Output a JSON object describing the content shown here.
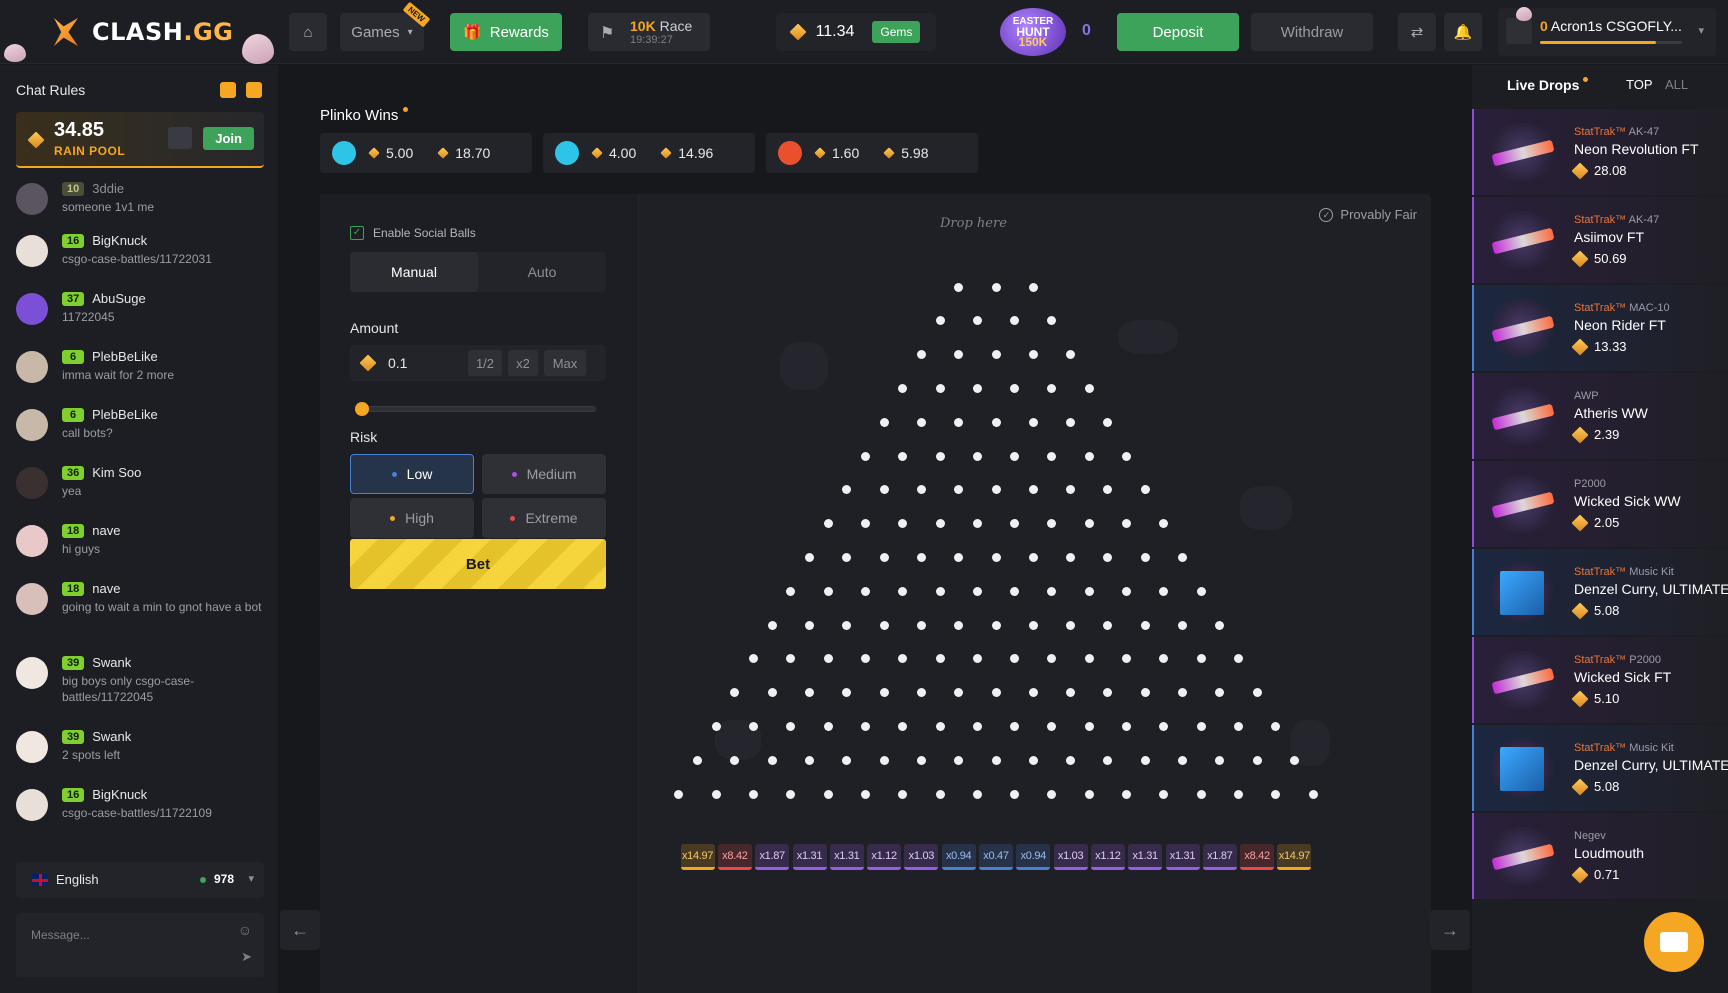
{
  "brand": {
    "name": "CLASH",
    "suffix": ".GG"
  },
  "topbar": {
    "games_label": "Games",
    "new_tag": "NEW",
    "rewards_label": "Rewards",
    "race_amount": "10K",
    "race_label": "Race",
    "race_timer": "19:39:27",
    "balance": "11.34",
    "gems_label": "Gems",
    "easter_line1": "EASTER",
    "easter_line2": "HUNT",
    "easter_line3": "150K",
    "easter_count": "0",
    "deposit_label": "Deposit",
    "withdraw_label": "Withdraw",
    "user_level": "0",
    "user_name": "Acron1s CSGOFLY..."
  },
  "chat": {
    "title": "Chat Rules",
    "rain_amount": "34.85",
    "rain_label": "RAIN POOL",
    "join_label": "Join",
    "messages": [
      {
        "level": "10",
        "user": "3ddie",
        "text": "someone 1v1 me",
        "dim": true
      },
      {
        "level": "16",
        "user": "BigKnuck",
        "text": "csgo-case-battles/11722031"
      },
      {
        "level": "37",
        "user": "AbuSuge",
        "text": "11722045"
      },
      {
        "level": "6",
        "user": "PlebBeLike",
        "text": "imma wait for 2 more"
      },
      {
        "level": "6",
        "user": "PlebBeLike",
        "text": "call bots?"
      },
      {
        "level": "36",
        "user": "Kim Soo",
        "text": "yea"
      },
      {
        "level": "18",
        "user": "nave",
        "text": "hi guys"
      },
      {
        "level": "18",
        "user": "nave",
        "text": "going to wait a min to gnot have a bot"
      },
      {
        "level": "39",
        "user": "Swank",
        "text": "big boys only csgo-case-battles/11722045"
      },
      {
        "level": "39",
        "user": "Swank",
        "text": "2 spots left"
      },
      {
        "level": "16",
        "user": "BigKnuck",
        "text": "csgo-case-battles/11722109"
      }
    ],
    "language": "English",
    "online_count": "978",
    "message_placeholder": "Message..."
  },
  "plinko_wins": {
    "title": "Plinko Wins",
    "cards": [
      {
        "bet": "5.00",
        "win": "18.70",
        "icon_color": "#2ec4e8"
      },
      {
        "bet": "4.00",
        "win": "14.96",
        "icon_color": "#2ec4e8"
      },
      {
        "bet": "1.60",
        "win": "5.98",
        "icon_color": "#e8502e"
      }
    ]
  },
  "controls": {
    "social_balls_label": "Enable Social Balls",
    "tab_manual": "Manual",
    "tab_auto": "Auto",
    "amount_label": "Amount",
    "amount_value": "0.1",
    "half_label": "1/2",
    "double_label": "x2",
    "max_label": "Max",
    "slider_value": 0,
    "risk_label": "Risk",
    "risk_low": "Low",
    "risk_medium": "Medium",
    "risk_high": "High",
    "risk_extreme": "Extreme",
    "bet_label": "Bet"
  },
  "board": {
    "provably_fair": "Provably Fair",
    "drop_here": "Drop here",
    "multipliers": [
      "x14.97",
      "x8.42",
      "x1.87",
      "x1.31",
      "x1.31",
      "x1.12",
      "x1.03",
      "x0.94",
      "x0.47",
      "x0.94",
      "x1.03",
      "x1.12",
      "x1.31",
      "x1.31",
      "x1.87",
      "x8.42",
      "x14.97"
    ],
    "multiplier_colors": [
      "#f5a623",
      "#e84a4a",
      "#9a5ae8",
      "#9a5ae8",
      "#9a5ae8",
      "#9a5ae8",
      "#9a5ae8",
      "#4a7fd6",
      "#4a7fd6",
      "#4a7fd6",
      "#9a5ae8",
      "#9a5ae8",
      "#9a5ae8",
      "#9a5ae8",
      "#9a5ae8",
      "#e84a4a",
      "#f5a623"
    ]
  },
  "live_drops": {
    "title": "Live Drops",
    "top_label": "TOP",
    "all_label": "ALL",
    "items": [
      {
        "stattrak": "StatTrak™",
        "type": "AK-47",
        "name": "Neon Revolution FT",
        "price": "28.08",
        "kit": false
      },
      {
        "stattrak": "StatTrak™",
        "type": "AK-47",
        "name": "Asiimov FT",
        "price": "50.69",
        "kit": false
      },
      {
        "stattrak": "StatTrak™",
        "type": "MAC-10",
        "name": "Neon Rider FT",
        "price": "13.33",
        "kit": false
      },
      {
        "stattrak": "",
        "type": "AWP",
        "name": "Atheris WW",
        "price": "2.39",
        "kit": false
      },
      {
        "stattrak": "",
        "type": "P2000",
        "name": "Wicked Sick WW",
        "price": "2.05",
        "kit": false
      },
      {
        "stattrak": "StatTrak™",
        "type": "Music Kit",
        "name": "Denzel Curry, ULTIMATE",
        "price": "5.08",
        "kit": true
      },
      {
        "stattrak": "StatTrak™",
        "type": "P2000",
        "name": "Wicked Sick FT",
        "price": "5.10",
        "kit": false
      },
      {
        "stattrak": "StatTrak™",
        "type": "Music Kit",
        "name": "Denzel Curry, ULTIMATE",
        "price": "5.08",
        "kit": true
      },
      {
        "stattrak": "",
        "type": "Negev",
        "name": "Loudmouth",
        "price": "0.71",
        "kit": false
      }
    ]
  }
}
